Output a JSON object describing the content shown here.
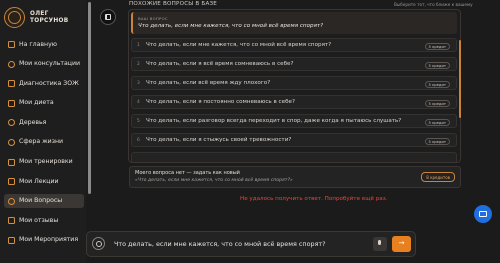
{
  "brand": {
    "line1": "ОЛЕГ",
    "line2": "ТОРСУНОВ"
  },
  "sidebar": {
    "items": [
      {
        "label": "На главную",
        "active": false
      },
      {
        "label": "Мои консультации",
        "active": false
      },
      {
        "label": "Диагностика ЗОЖ",
        "active": false
      },
      {
        "label": "Мои диета",
        "active": false
      },
      {
        "label": "Деревья",
        "active": false
      },
      {
        "label": "Сфера жизни",
        "active": false
      },
      {
        "label": "Мои тренировки",
        "active": false
      },
      {
        "label": "Мои Лекции",
        "active": false
      },
      {
        "label": "Мои Вопросы",
        "active": true
      },
      {
        "label": "Мои отзывы",
        "active": false
      },
      {
        "label": "Мои Мероприятия",
        "active": false
      }
    ]
  },
  "header": {
    "section_title": "ПОХОЖИЕ ВОПРОСЫ В БАЗЕ",
    "hint": "Выберите тот, что ближе к вашему"
  },
  "selected_question": {
    "label": "ВАШ ВОПРОС",
    "text": "Что делать, если мне кажется, что со мной всё время спорят?"
  },
  "similar_questions": [
    {
      "num": "1",
      "text": "Что делать, если мне кажется, что со мной всё время спорят?",
      "action": "5 кредит"
    },
    {
      "num": "2",
      "text": "Что делать, если я всё время сомневаюсь в себе?",
      "action": "5 кредит"
    },
    {
      "num": "3",
      "text": "Что делать, если всё время жду плохого?",
      "action": "5 кредит"
    },
    {
      "num": "4",
      "text": "Что делать, если я постоянно сомневаюсь в себе?",
      "action": "5 кредит"
    },
    {
      "num": "5",
      "text": "Что делать, если разговор всегда переходит в спор, даже когда я пытаюсь слушать?",
      "action": "5 кредит"
    },
    {
      "num": "6",
      "text": "Что делать, если я стыжусь своей тревожности?",
      "action": "5 кредит"
    }
  ],
  "no_question": {
    "title": "Моего вопроса нет — задать как новый",
    "text": "«Что делать, если мне кажется, что со мной всё время спорят?»",
    "action": "8 кредитов"
  },
  "error_text": "Не удалось получить ответ. Попробуйте ещё раз.",
  "input": {
    "value": "Что делать, если мне кажется, что со мной всё время спорят?",
    "send_glyph": "→"
  },
  "colors": {
    "accent": "#e8801f",
    "error": "#e24a3a",
    "chat_button": "#1f6fe0"
  }
}
